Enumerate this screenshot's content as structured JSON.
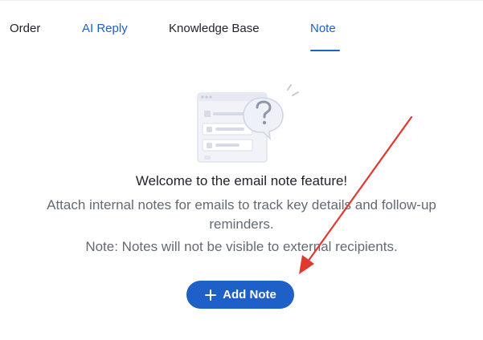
{
  "tabs": [
    {
      "label": "Order"
    },
    {
      "label": "AI Reply"
    },
    {
      "label": "Knowledge Base"
    },
    {
      "label": "Note"
    }
  ],
  "active_tab": "Note",
  "empty_state": {
    "title": "Welcome to the email note feature!",
    "description": "Attach internal notes for emails to track key details and follow-up reminders.",
    "note": "Note: Notes will not be visible to external recipients.",
    "illustration_icon": "question-bubble-illustration"
  },
  "add_note_button": {
    "label": "Add Note",
    "icon": "plus-icon"
  },
  "colors": {
    "accent": "#1e5fc8",
    "annotation_arrow": "#e03a2f",
    "text_primary": "#1f2329",
    "text_secondary": "#646a73"
  }
}
